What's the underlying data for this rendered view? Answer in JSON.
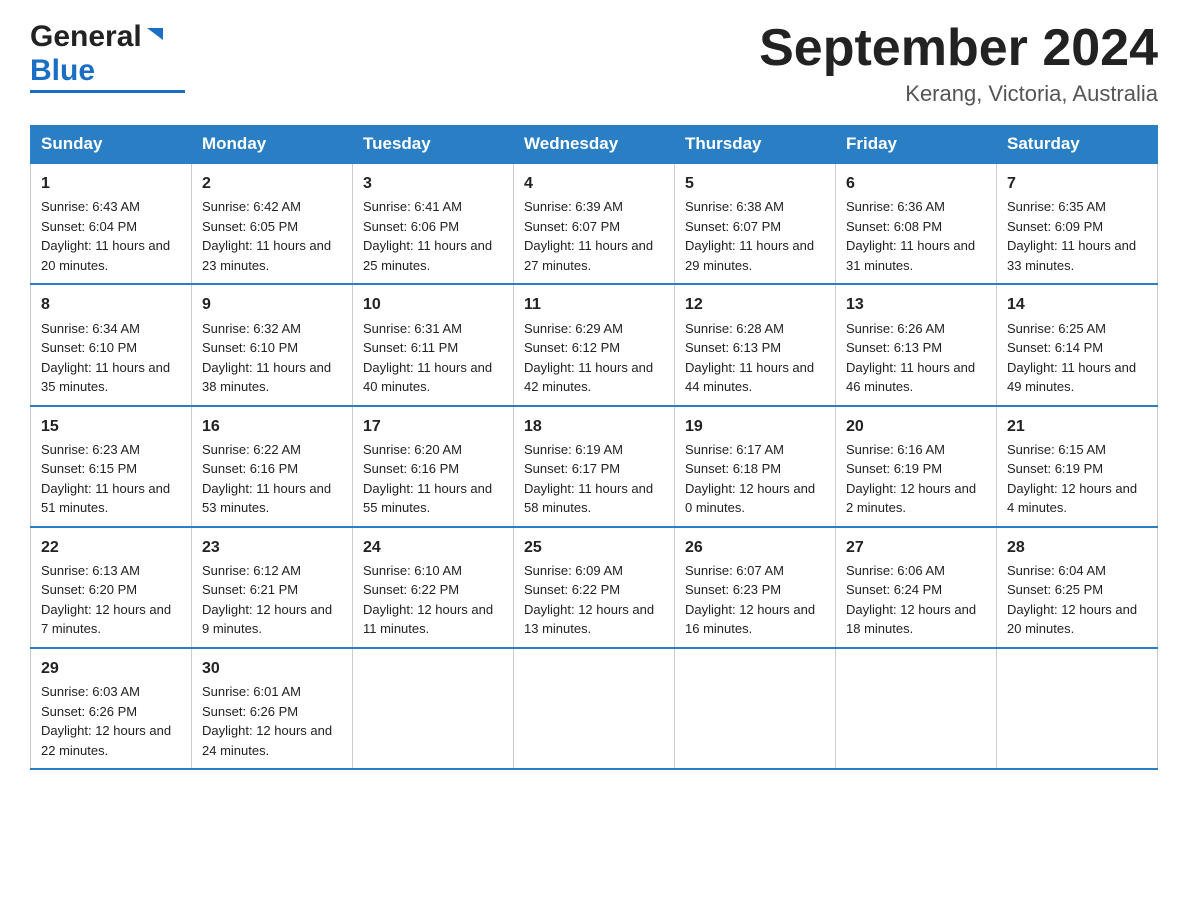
{
  "header": {
    "logo_general": "General",
    "logo_blue": "Blue",
    "month_title": "September 2024",
    "location": "Kerang, Victoria, Australia"
  },
  "weekdays": [
    "Sunday",
    "Monday",
    "Tuesday",
    "Wednesday",
    "Thursday",
    "Friday",
    "Saturday"
  ],
  "weeks": [
    [
      {
        "day": "1",
        "sunrise": "Sunrise: 6:43 AM",
        "sunset": "Sunset: 6:04 PM",
        "daylight": "Daylight: 11 hours and 20 minutes."
      },
      {
        "day": "2",
        "sunrise": "Sunrise: 6:42 AM",
        "sunset": "Sunset: 6:05 PM",
        "daylight": "Daylight: 11 hours and 23 minutes."
      },
      {
        "day": "3",
        "sunrise": "Sunrise: 6:41 AM",
        "sunset": "Sunset: 6:06 PM",
        "daylight": "Daylight: 11 hours and 25 minutes."
      },
      {
        "day": "4",
        "sunrise": "Sunrise: 6:39 AM",
        "sunset": "Sunset: 6:07 PM",
        "daylight": "Daylight: 11 hours and 27 minutes."
      },
      {
        "day": "5",
        "sunrise": "Sunrise: 6:38 AM",
        "sunset": "Sunset: 6:07 PM",
        "daylight": "Daylight: 11 hours and 29 minutes."
      },
      {
        "day": "6",
        "sunrise": "Sunrise: 6:36 AM",
        "sunset": "Sunset: 6:08 PM",
        "daylight": "Daylight: 11 hours and 31 minutes."
      },
      {
        "day": "7",
        "sunrise": "Sunrise: 6:35 AM",
        "sunset": "Sunset: 6:09 PM",
        "daylight": "Daylight: 11 hours and 33 minutes."
      }
    ],
    [
      {
        "day": "8",
        "sunrise": "Sunrise: 6:34 AM",
        "sunset": "Sunset: 6:10 PM",
        "daylight": "Daylight: 11 hours and 35 minutes."
      },
      {
        "day": "9",
        "sunrise": "Sunrise: 6:32 AM",
        "sunset": "Sunset: 6:10 PM",
        "daylight": "Daylight: 11 hours and 38 minutes."
      },
      {
        "day": "10",
        "sunrise": "Sunrise: 6:31 AM",
        "sunset": "Sunset: 6:11 PM",
        "daylight": "Daylight: 11 hours and 40 minutes."
      },
      {
        "day": "11",
        "sunrise": "Sunrise: 6:29 AM",
        "sunset": "Sunset: 6:12 PM",
        "daylight": "Daylight: 11 hours and 42 minutes."
      },
      {
        "day": "12",
        "sunrise": "Sunrise: 6:28 AM",
        "sunset": "Sunset: 6:13 PM",
        "daylight": "Daylight: 11 hours and 44 minutes."
      },
      {
        "day": "13",
        "sunrise": "Sunrise: 6:26 AM",
        "sunset": "Sunset: 6:13 PM",
        "daylight": "Daylight: 11 hours and 46 minutes."
      },
      {
        "day": "14",
        "sunrise": "Sunrise: 6:25 AM",
        "sunset": "Sunset: 6:14 PM",
        "daylight": "Daylight: 11 hours and 49 minutes."
      }
    ],
    [
      {
        "day": "15",
        "sunrise": "Sunrise: 6:23 AM",
        "sunset": "Sunset: 6:15 PM",
        "daylight": "Daylight: 11 hours and 51 minutes."
      },
      {
        "day": "16",
        "sunrise": "Sunrise: 6:22 AM",
        "sunset": "Sunset: 6:16 PM",
        "daylight": "Daylight: 11 hours and 53 minutes."
      },
      {
        "day": "17",
        "sunrise": "Sunrise: 6:20 AM",
        "sunset": "Sunset: 6:16 PM",
        "daylight": "Daylight: 11 hours and 55 minutes."
      },
      {
        "day": "18",
        "sunrise": "Sunrise: 6:19 AM",
        "sunset": "Sunset: 6:17 PM",
        "daylight": "Daylight: 11 hours and 58 minutes."
      },
      {
        "day": "19",
        "sunrise": "Sunrise: 6:17 AM",
        "sunset": "Sunset: 6:18 PM",
        "daylight": "Daylight: 12 hours and 0 minutes."
      },
      {
        "day": "20",
        "sunrise": "Sunrise: 6:16 AM",
        "sunset": "Sunset: 6:19 PM",
        "daylight": "Daylight: 12 hours and 2 minutes."
      },
      {
        "day": "21",
        "sunrise": "Sunrise: 6:15 AM",
        "sunset": "Sunset: 6:19 PM",
        "daylight": "Daylight: 12 hours and 4 minutes."
      }
    ],
    [
      {
        "day": "22",
        "sunrise": "Sunrise: 6:13 AM",
        "sunset": "Sunset: 6:20 PM",
        "daylight": "Daylight: 12 hours and 7 minutes."
      },
      {
        "day": "23",
        "sunrise": "Sunrise: 6:12 AM",
        "sunset": "Sunset: 6:21 PM",
        "daylight": "Daylight: 12 hours and 9 minutes."
      },
      {
        "day": "24",
        "sunrise": "Sunrise: 6:10 AM",
        "sunset": "Sunset: 6:22 PM",
        "daylight": "Daylight: 12 hours and 11 minutes."
      },
      {
        "day": "25",
        "sunrise": "Sunrise: 6:09 AM",
        "sunset": "Sunset: 6:22 PM",
        "daylight": "Daylight: 12 hours and 13 minutes."
      },
      {
        "day": "26",
        "sunrise": "Sunrise: 6:07 AM",
        "sunset": "Sunset: 6:23 PM",
        "daylight": "Daylight: 12 hours and 16 minutes."
      },
      {
        "day": "27",
        "sunrise": "Sunrise: 6:06 AM",
        "sunset": "Sunset: 6:24 PM",
        "daylight": "Daylight: 12 hours and 18 minutes."
      },
      {
        "day": "28",
        "sunrise": "Sunrise: 6:04 AM",
        "sunset": "Sunset: 6:25 PM",
        "daylight": "Daylight: 12 hours and 20 minutes."
      }
    ],
    [
      {
        "day": "29",
        "sunrise": "Sunrise: 6:03 AM",
        "sunset": "Sunset: 6:26 PM",
        "daylight": "Daylight: 12 hours and 22 minutes."
      },
      {
        "day": "30",
        "sunrise": "Sunrise: 6:01 AM",
        "sunset": "Sunset: 6:26 PM",
        "daylight": "Daylight: 12 hours and 24 minutes."
      },
      null,
      null,
      null,
      null,
      null
    ]
  ]
}
